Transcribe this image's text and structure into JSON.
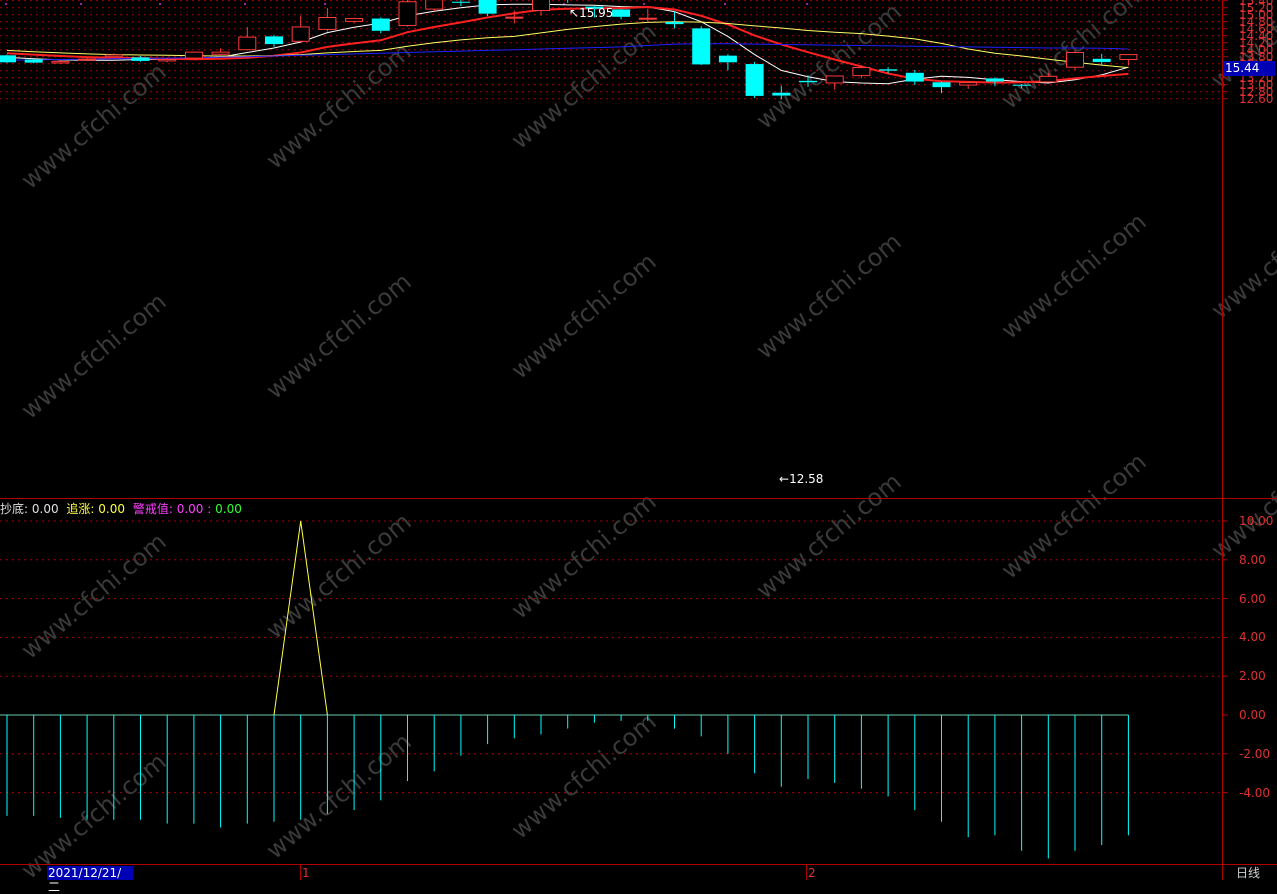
{
  "legend": {
    "buy_label": "抄底:",
    "buy_value": "0.00",
    "chase_label": "追涨:",
    "chase_value": "0.00",
    "warn_label": "警戒值:",
    "warn_value1": "0.00",
    "warn_sep": ":",
    "warn_value2": "0.00"
  },
  "price_axis": [
    "15.80",
    "15.60",
    "15.40",
    "15.20",
    "15.00",
    "14.80",
    "14.60",
    "14.40",
    "14.20",
    "14.00",
    "13.80",
    "13.60",
    "13.40",
    "13.20",
    "13.00",
    "12.80",
    "12.60"
  ],
  "ind_axis": [
    "10.00",
    "8.00",
    "6.00",
    "4.00",
    "2.00",
    "0.00",
    "-2.00",
    "-4.00"
  ],
  "current_price": "15.44",
  "high_marker": "15.95",
  "low_marker": "12.58",
  "date_label": "2021/12/21/二",
  "month_1": "1",
  "month_2": "2",
  "period": "日线",
  "watermark": "www.cfchi.com",
  "colors": {
    "up": "#ff3b3b",
    "down": "#00ffff",
    "ma5": "#ffffff",
    "ma10": "#ff2020",
    "ma20": "#ffff66",
    "ma60": "#2020ff",
    "grid": "#b00000",
    "price_tag": "#0000b4"
  },
  "chart_data": {
    "type": "candlestick",
    "ylim": [
      12.45,
      15.95
    ],
    "candles": [
      {
        "o": 13.84,
        "c": 13.64,
        "h": 13.86,
        "l": 13.62
      },
      {
        "o": 13.72,
        "c": 13.63,
        "h": 13.74,
        "l": 13.61
      },
      {
        "o": 13.62,
        "c": 13.66,
        "h": 13.69,
        "l": 13.6
      },
      {
        "o": 13.72,
        "c": 13.73,
        "h": 13.76,
        "l": 13.7
      },
      {
        "o": 13.8,
        "c": 13.85,
        "h": 13.9,
        "l": 13.78
      },
      {
        "o": 13.78,
        "c": 13.68,
        "h": 13.82,
        "l": 13.66
      },
      {
        "o": 13.68,
        "c": 13.72,
        "h": 13.76,
        "l": 13.64
      },
      {
        "o": 13.76,
        "c": 13.93,
        "h": 13.95,
        "l": 13.74
      },
      {
        "o": 13.87,
        "c": 13.93,
        "h": 14.04,
        "l": 13.85
      },
      {
        "o": 14.0,
        "c": 14.36,
        "h": 14.65,
        "l": 13.98
      },
      {
        "o": 14.38,
        "c": 14.16,
        "h": 14.42,
        "l": 14.08
      },
      {
        "o": 14.24,
        "c": 14.65,
        "h": 14.97,
        "l": 14.22
      },
      {
        "o": 14.58,
        "c": 14.92,
        "h": 15.19,
        "l": 14.52
      },
      {
        "o": 14.81,
        "c": 14.89,
        "h": 14.91,
        "l": 14.75
      },
      {
        "o": 14.89,
        "c": 14.54,
        "h": 14.92,
        "l": 14.47
      },
      {
        "o": 14.69,
        "c": 15.37,
        "h": 15.85,
        "l": 14.66
      },
      {
        "o": 15.16,
        "c": 15.43,
        "h": 15.54,
        "l": 15.1
      },
      {
        "o": 15.37,
        "c": 15.35,
        "h": 15.51,
        "l": 15.25
      },
      {
        "o": 15.51,
        "c": 15.03,
        "h": 15.64,
        "l": 14.96
      },
      {
        "o": 14.9,
        "c": 14.93,
        "h": 15.12,
        "l": 14.75
      },
      {
        "o": 15.12,
        "c": 15.58,
        "h": 15.79,
        "l": 14.97
      },
      {
        "o": 15.51,
        "c": 15.45,
        "h": 15.95,
        "l": 15.34
      },
      {
        "o": 15.23,
        "c": 15.17,
        "h": 15.25,
        "l": 14.92
      },
      {
        "o": 15.15,
        "c": 14.94,
        "h": 15.16,
        "l": 14.87
      },
      {
        "o": 14.88,
        "c": 14.9,
        "h": 15.17,
        "l": 14.78
      },
      {
        "o": 14.79,
        "c": 14.73,
        "h": 15.09,
        "l": 14.61
      },
      {
        "o": 14.61,
        "c": 13.58,
        "h": 14.67,
        "l": 13.56
      },
      {
        "o": 13.83,
        "c": 13.64,
        "h": 13.87,
        "l": 13.41
      },
      {
        "o": 13.59,
        "c": 12.68,
        "h": 13.65,
        "l": 12.62
      },
      {
        "o": 12.77,
        "c": 12.69,
        "h": 12.97,
        "l": 12.58
      },
      {
        "o": 13.11,
        "c": 13.07,
        "h": 13.27,
        "l": 12.94
      },
      {
        "o": 13.05,
        "c": 13.25,
        "h": 13.26,
        "l": 12.86
      },
      {
        "o": 13.26,
        "c": 13.49,
        "h": 13.56,
        "l": 13.19
      },
      {
        "o": 13.44,
        "c": 13.4,
        "h": 13.5,
        "l": 13.32
      },
      {
        "o": 13.34,
        "c": 13.09,
        "h": 13.42,
        "l": 12.99
      },
      {
        "o": 13.07,
        "c": 12.93,
        "h": 13.1,
        "l": 12.76
      },
      {
        "o": 12.99,
        "c": 13.06,
        "h": 13.09,
        "l": 12.88
      },
      {
        "o": 13.18,
        "c": 13.09,
        "h": 13.21,
        "l": 12.96
      },
      {
        "o": 13.0,
        "c": 12.97,
        "h": 13.02,
        "l": 12.9
      },
      {
        "o": 13.08,
        "c": 13.24,
        "h": 13.34,
        "l": 13.06
      },
      {
        "o": 13.5,
        "c": 13.92,
        "h": 13.97,
        "l": 13.42
      },
      {
        "o": 13.74,
        "c": 13.65,
        "h": 13.88,
        "l": 13.56
      },
      {
        "o": 13.72,
        "c": 13.86,
        "h": 13.87,
        "l": 13.55
      }
    ],
    "ma_series": [
      {
        "key": "ma5",
        "values": [
          13.78,
          13.74,
          13.71,
          13.7,
          13.7,
          13.72,
          13.73,
          13.76,
          13.79,
          13.92,
          14.05,
          14.22,
          14.49,
          14.64,
          14.76,
          14.97,
          15.1,
          15.2,
          15.28,
          15.3,
          15.3,
          15.28,
          15.27,
          15.23,
          15.22,
          15.09,
          14.8,
          14.38,
          13.86,
          13.41,
          13.23,
          13.09,
          13.05,
          13.03,
          13.16,
          13.24,
          13.21,
          13.14,
          13.09,
          13.05,
          13.14,
          13.28,
          13.5
        ]
      },
      {
        "key": "ma10",
        "values": [
          13.9,
          13.86,
          13.82,
          13.79,
          13.77,
          13.76,
          13.74,
          13.73,
          13.74,
          13.77,
          13.83,
          13.92,
          14.08,
          14.18,
          14.27,
          14.5,
          14.65,
          14.78,
          14.92,
          15.04,
          15.14,
          15.17,
          15.18,
          15.19,
          15.22,
          15.15,
          14.97,
          14.72,
          14.41,
          14.15,
          13.93,
          13.72,
          13.52,
          13.32,
          13.17,
          13.1,
          13.08,
          13.06,
          13.07,
          13.1,
          13.18,
          13.25,
          13.31
        ]
      },
      {
        "key": "ma20",
        "values": [
          13.98,
          13.94,
          13.91,
          13.88,
          13.86,
          13.85,
          13.84,
          13.83,
          13.82,
          13.82,
          13.83,
          13.86,
          13.91,
          13.95,
          13.98,
          14.1,
          14.2,
          14.28,
          14.34,
          14.38,
          14.48,
          14.58,
          14.66,
          14.73,
          14.78,
          14.8,
          14.79,
          14.75,
          14.68,
          14.62,
          14.55,
          14.5,
          14.46,
          14.39,
          14.31,
          14.18,
          14.02,
          13.9,
          13.82,
          13.73,
          13.64,
          13.56,
          13.49
        ]
      },
      {
        "key": "ma60",
        "values": [
          13.7,
          13.71,
          13.72,
          13.73,
          13.74,
          13.75,
          13.76,
          13.77,
          13.79,
          13.8,
          13.82,
          13.84,
          13.86,
          13.88,
          13.9,
          13.92,
          13.94,
          13.96,
          13.98,
          14.0,
          14.02,
          14.04,
          14.06,
          14.08,
          14.12,
          14.16,
          14.17,
          14.17,
          14.16,
          14.15,
          14.14,
          14.13,
          14.12,
          14.11,
          14.1,
          14.09,
          14.08,
          14.07,
          14.06,
          14.05,
          14.05,
          14.04,
          14.02
        ]
      }
    ],
    "indicator": {
      "ylim": [
        -7.4,
        10.6
      ],
      "peak_index": 11,
      "peak_value": 10.0,
      "bars": [
        -5.2,
        -5.2,
        -5.3,
        -5.4,
        -5.4,
        -5.4,
        -5.6,
        -5.6,
        -5.8,
        -5.6,
        -5.5,
        -5.4,
        -5.1,
        -4.9,
        -4.4,
        -3.4,
        -2.9,
        -2.1,
        -1.5,
        -1.2,
        -1.0,
        -0.7,
        -0.4,
        -0.3,
        -0.3,
        -0.7,
        -1.1,
        -2.0,
        -3.0,
        -3.7,
        -3.3,
        -3.5,
        -3.8,
        -4.2,
        -4.9,
        -5.5,
        -6.3,
        -6.2,
        -7.0,
        -7.4,
        -7.0,
        -6.7,
        -6.2
      ]
    }
  }
}
